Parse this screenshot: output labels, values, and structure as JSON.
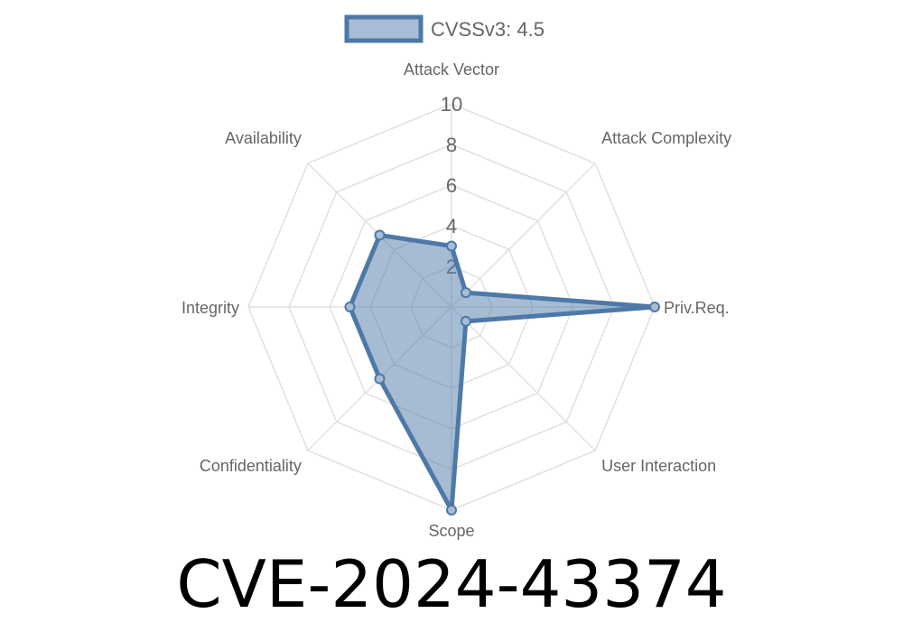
{
  "page": {
    "cve_id": "CVE-2024-43374"
  },
  "chart_data": {
    "type": "radar",
    "title": "",
    "legend": {
      "position": "top",
      "entries": [
        "CVSSv3: 4.5"
      ]
    },
    "axes": [
      "Attack Vector",
      "Attack Complexity",
      "Priv.Req.",
      "User Interaction",
      "Scope",
      "Confidentiality",
      "Integrity",
      "Availability"
    ],
    "r_ticks": [
      "2",
      "4",
      "6",
      "8",
      "10"
    ],
    "r_range": [
      0,
      10
    ],
    "grid": true,
    "series": [
      {
        "name": "CVSSv3: 4.5",
        "values": [
          3,
          1,
          10,
          1,
          10,
          5,
          5,
          5
        ]
      }
    ],
    "colors": {
      "line": "#4e79a7",
      "fill": "#4e79a7",
      "fill_opacity": 0.5,
      "grid": "#e0e0e0",
      "label": "#666666"
    }
  }
}
